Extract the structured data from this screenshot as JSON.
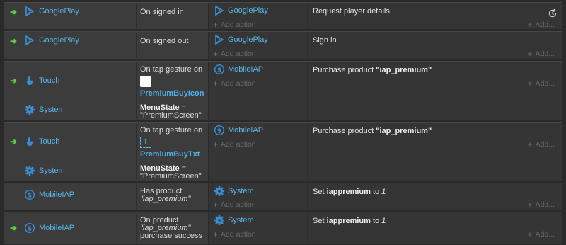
{
  "add_action_label": "Add action",
  "add_more_label": "Add...",
  "events": [
    {
      "triggers": [
        {
          "object": "GooglePlay",
          "icon": "googleplay-icon"
        }
      ],
      "condition": {
        "text": "On signed in"
      },
      "actions": [
        {
          "object": "GooglePlay",
          "icon": "googleplay-icon",
          "parts": [
            "Request player details"
          ]
        }
      ]
    },
    {
      "triggers": [
        {
          "object": "GooglePlay",
          "icon": "googleplay-icon"
        }
      ],
      "condition": {
        "text": "On signed out"
      },
      "actions": [
        {
          "object": "GooglePlay",
          "icon": "googleplay-icon",
          "parts": [
            "Sign in"
          ]
        }
      ]
    },
    {
      "triggers": [
        {
          "object": "Touch",
          "icon": "touch-icon"
        },
        {
          "object": "System",
          "icon": "gear-icon"
        }
      ],
      "condition": {
        "line1": "On tap gesture on",
        "target": "PremiumBuyIcon",
        "var": "MenuState",
        "eq": " =",
        "value": "\"PremiumScreen\""
      },
      "actions": [
        {
          "object": "MobileIAP",
          "icon": "mobileiap-icon",
          "prefix": "Purchase product ",
          "bold": "\"iap_premium\""
        }
      ]
    },
    {
      "triggers": [
        {
          "object": "Touch",
          "icon": "touch-icon"
        },
        {
          "object": "System",
          "icon": "gear-icon"
        }
      ],
      "condition": {
        "line1": "On tap gesture on",
        "target": "PremiumBuyTxt",
        "var": "MenuState",
        "eq": " =",
        "value": "\"PremiumScreen\""
      },
      "actions": [
        {
          "object": "MobileIAP",
          "icon": "mobileiap-icon",
          "prefix": "Purchase product ",
          "bold": "\"iap_premium\""
        }
      ]
    },
    {
      "triggers": [
        {
          "object": "MobileIAP",
          "icon": "mobileiap-icon"
        }
      ],
      "condition": {
        "line1": "Has product",
        "italic": "\"iap_premium\""
      },
      "actions": [
        {
          "object": "System",
          "icon": "gear-icon",
          "prefix": "Set ",
          "bold": "iappremium",
          "mid": " to ",
          "italic": "1"
        }
      ]
    },
    {
      "triggers": [
        {
          "object": "MobileIAP",
          "icon": "mobileiap-icon"
        }
      ],
      "condition": {
        "line1": "On product",
        "italic": "\"iap_premium\"",
        "line3": "purchase success"
      },
      "actions": [
        {
          "object": "System",
          "icon": "gear-icon",
          "prefix": "Set ",
          "bold": "iappremium",
          "mid": " to ",
          "italic": "1"
        }
      ]
    }
  ],
  "colors": {
    "object_link": "#58b6e8",
    "arrow": "#5fcf3f",
    "background": "#2a2a2a"
  }
}
